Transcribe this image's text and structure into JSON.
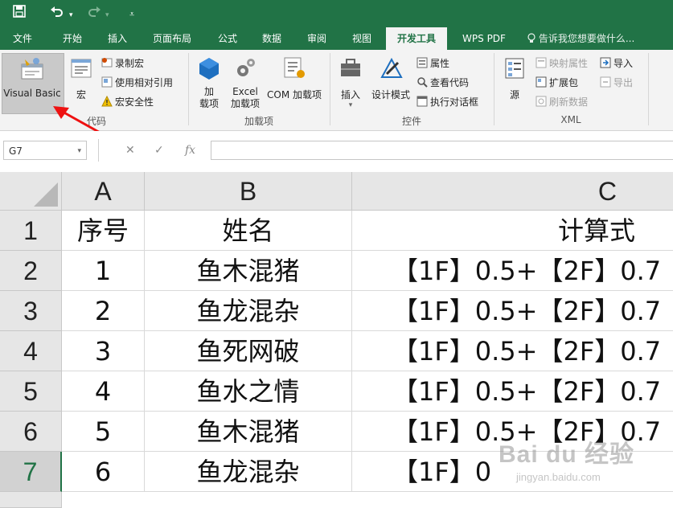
{
  "quick_access": {
    "save_icon": "save-icon",
    "undo_icon": "undo-icon",
    "redo_icon": "redo-icon",
    "customize_icon": "customize-icon"
  },
  "tabs": [
    {
      "label": "文件"
    },
    {
      "label": "开始"
    },
    {
      "label": "插入"
    },
    {
      "label": "页面布局"
    },
    {
      "label": "公式"
    },
    {
      "label": "数据"
    },
    {
      "label": "审阅"
    },
    {
      "label": "视图"
    },
    {
      "label": "开发工具"
    },
    {
      "label": "WPS PDF"
    }
  ],
  "tell_me": "告诉我您想要做什么...",
  "ribbon": {
    "code": {
      "visual_basic": "Visual Basic",
      "macro": "宏",
      "record_macro": "录制宏",
      "relative_ref": "使用相对引用",
      "macro_security": "宏安全性",
      "group_label": "代码"
    },
    "addins": {
      "addin": "加\n载项",
      "addin_l1": "加",
      "addin_l2": "载项",
      "excel_addin_l1": "Excel",
      "excel_addin_l2": "加载项",
      "com_addin": "COM 加载项",
      "group_label": "加载项"
    },
    "controls": {
      "insert": "插入",
      "design_mode": "设计模式",
      "properties": "属性",
      "view_code": "查看代码",
      "run_dialog": "执行对话框",
      "group_label": "控件"
    },
    "xml": {
      "source": "源",
      "map_properties": "映射属性",
      "expansion_packs": "扩展包",
      "refresh_data": "刷新数据",
      "import": "导入",
      "export": "导出",
      "group_label": "XML"
    }
  },
  "formula_bar": {
    "name_box": "G7",
    "cancel": "✕",
    "enter": "✓",
    "fx": "fx"
  },
  "columns": [
    "A",
    "B",
    "C"
  ],
  "rows": [
    {
      "num": "1",
      "a": "序号",
      "b": "姓名",
      "c": "计算式"
    },
    {
      "num": "2",
      "a": "1",
      "b": "鱼木混猪",
      "c": "【1F】0.5+【2F】0.7"
    },
    {
      "num": "3",
      "a": "2",
      "b": "鱼龙混杂",
      "c": "【1F】0.5+【2F】0.7"
    },
    {
      "num": "4",
      "a": "3",
      "b": "鱼死网破",
      "c": "【1F】0.5+【2F】0.7"
    },
    {
      "num": "5",
      "a": "4",
      "b": "鱼水之情",
      "c": "【1F】0.5+【2F】0.7"
    },
    {
      "num": "6",
      "a": "5",
      "b": "鱼木混猪",
      "c": "【1F】0.5+【2F】0.7"
    },
    {
      "num": "7",
      "a": "6",
      "b": "鱼龙混杂",
      "c": "【1F】0"
    }
  ],
  "selected_cell": "G7",
  "watermark": {
    "brand": "Bai du 经验",
    "url": "jingyan.baidu.com"
  }
}
